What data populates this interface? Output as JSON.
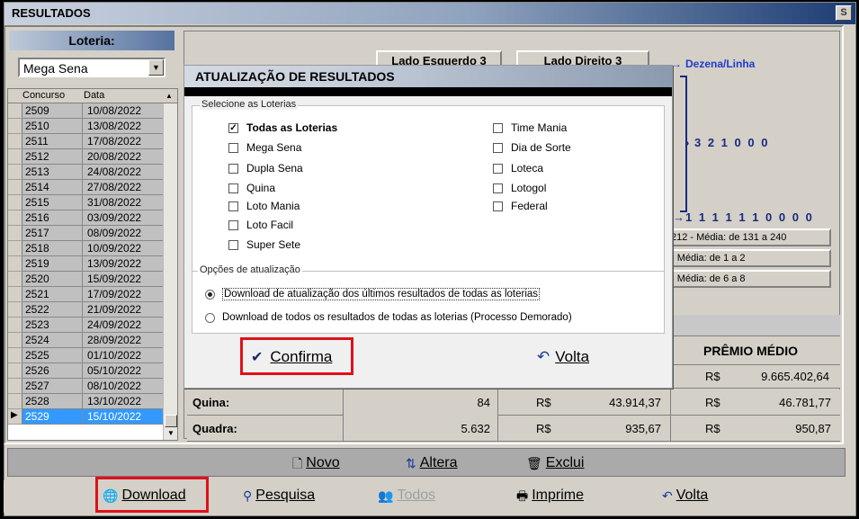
{
  "window": {
    "title": "RESULTADOS",
    "corner_icon": "S"
  },
  "left": {
    "loteria_label": "Loteria:",
    "selected_loteria": "Mega Sena",
    "grid": {
      "col_concurso": "Concurso",
      "col_data": "Data",
      "rows": [
        {
          "concurso": "2509",
          "data": "10/08/2022"
        },
        {
          "concurso": "2510",
          "data": "13/08/2022"
        },
        {
          "concurso": "2511",
          "data": "17/08/2022"
        },
        {
          "concurso": "2512",
          "data": "20/08/2022"
        },
        {
          "concurso": "2513",
          "data": "24/08/2022"
        },
        {
          "concurso": "2514",
          "data": "27/08/2022"
        },
        {
          "concurso": "2515",
          "data": "31/08/2022"
        },
        {
          "concurso": "2516",
          "data": "03/09/2022"
        },
        {
          "concurso": "2517",
          "data": "08/09/2022"
        },
        {
          "concurso": "2518",
          "data": "10/09/2022"
        },
        {
          "concurso": "2519",
          "data": "13/09/2022"
        },
        {
          "concurso": "2520",
          "data": "15/09/2022"
        },
        {
          "concurso": "2521",
          "data": "17/09/2022"
        },
        {
          "concurso": "2522",
          "data": "21/09/2022"
        },
        {
          "concurso": "2523",
          "data": "24/09/2022"
        },
        {
          "concurso": "2524",
          "data": "28/09/2022"
        },
        {
          "concurso": "2525",
          "data": "01/10/2022"
        },
        {
          "concurso": "2526",
          "data": "05/10/2022"
        },
        {
          "concurso": "2527",
          "data": "08/10/2022"
        },
        {
          "concurso": "2528",
          "data": "13/10/2022"
        },
        {
          "concurso": "2529",
          "data": "15/10/2022"
        }
      ]
    }
  },
  "right": {
    "lado_esquerdo": "Lado Esquerdo  3",
    "lado_direito": "Lado Direito  3",
    "dezena_linha": "Dezena/Linha",
    "seq1": "3 2 1 0 0 0",
    "seq2": "1 1 1 1 1 1 0 0 0 0",
    "info": [
      "212 - Média: de 131 a 240",
      "- Média: de 1 a 2",
      "- Média: de 6 a 8"
    ],
    "premio_medio": "PRÊMIO MÉDIO",
    "sena_row": {
      "rs": "R$",
      "media": "9.665.402,64"
    },
    "quina_row": {
      "label": "Quina:",
      "ganhadores": "84",
      "rs1": "R$",
      "premio": "43.914,37",
      "rs2": "R$",
      "media": "46.781,77"
    },
    "quadra_row": {
      "label": "Quadra:",
      "ganhadores": "5.632",
      "rs1": "R$",
      "premio": "935,67",
      "rs2": "R$",
      "media": "950,87"
    }
  },
  "toolbar1": {
    "novo": "Novo",
    "altera": "Altera",
    "exclui": "Exclui"
  },
  "toolbar2": {
    "download": "Download",
    "pesquisa": "Pesquisa",
    "todos": "Todos",
    "imprime": "Imprime",
    "volta": "Volta"
  },
  "modal": {
    "title": "ATUALIZAÇÃO DE RESULTADOS",
    "select_group": "Selecione as Loterias",
    "lotteries_left": [
      {
        "label": "Todas as Loterias",
        "checked": true
      },
      {
        "label": "Mega Sena",
        "checked": false
      },
      {
        "label": "Dupla Sena",
        "checked": false
      },
      {
        "label": "Quina",
        "checked": false
      },
      {
        "label": "Loto Mania",
        "checked": false
      },
      {
        "label": "Loto Facil",
        "checked": false
      },
      {
        "label": "Super Sete",
        "checked": false
      }
    ],
    "lotteries_right": [
      {
        "label": "Time Mania",
        "checked": false
      },
      {
        "label": "Dia de Sorte",
        "checked": false
      },
      {
        "label": "Loteca",
        "checked": false
      },
      {
        "label": "Lotogol",
        "checked": false
      },
      {
        "label": "Federal",
        "checked": false
      }
    ],
    "options_group": "Opções de atualização",
    "option1": "Download de atualização dos últimos resultados de todas as loterias",
    "option2": "Download de todos os resultados de todas as loterias (Processo Demorado)",
    "confirma": "Confirma",
    "volta": "Volta"
  },
  "colors": {
    "highlight_red": "#e0101a",
    "selection_blue": "#3399ff",
    "dezena_blue": "#1f3cc8"
  }
}
